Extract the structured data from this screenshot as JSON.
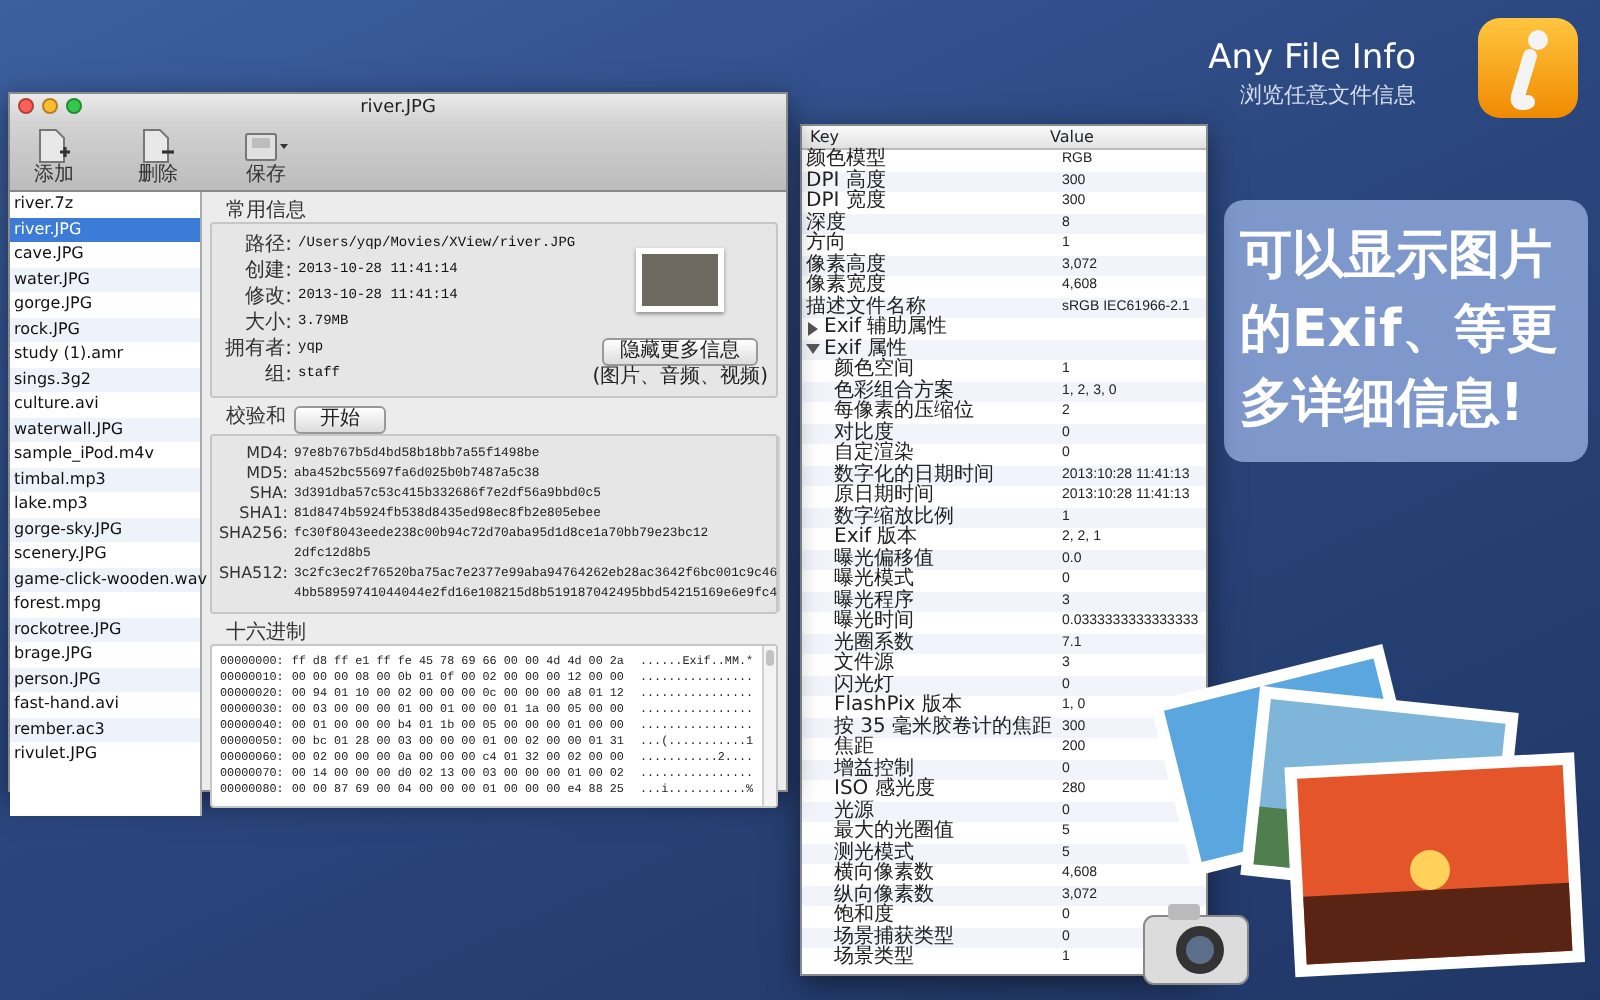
{
  "app": {
    "name": "Any File Info",
    "tagline": "浏览任意文件信息"
  },
  "callout": {
    "lines": [
      "可以显示图片",
      "的**Exif**、等更",
      "多详细信息!"
    ]
  },
  "main_window": {
    "title": "river.JPG",
    "toolbar": [
      {
        "kind": "add",
        "label": "添加"
      },
      {
        "kind": "remove",
        "label": "删除"
      },
      {
        "kind": "save",
        "label": "保存"
      }
    ],
    "files": [
      {
        "name": "river.7z",
        "selected": false
      },
      {
        "name": "river.JPG",
        "selected": true
      },
      {
        "name": "cave.JPG",
        "selected": false
      },
      {
        "name": "water.JPG",
        "selected": false
      },
      {
        "name": "gorge.JPG",
        "selected": false
      },
      {
        "name": "rock.JPG",
        "selected": false
      },
      {
        "name": "study (1).amr",
        "selected": false
      },
      {
        "name": "sings.3g2",
        "selected": false
      },
      {
        "name": "culture.avi",
        "selected": false
      },
      {
        "name": "waterwall.JPG",
        "selected": false
      },
      {
        "name": "sample_iPod.m4v",
        "selected": false
      },
      {
        "name": "timbal.mp3",
        "selected": false
      },
      {
        "name": "lake.mp3",
        "selected": false
      },
      {
        "name": "gorge-sky.JPG",
        "selected": false
      },
      {
        "name": "scenery.JPG",
        "selected": false
      },
      {
        "name": "game-click-wooden.wav",
        "selected": false
      },
      {
        "name": "forest.mpg",
        "selected": false
      },
      {
        "name": "rockotree.JPG",
        "selected": false
      },
      {
        "name": "brage.JPG",
        "selected": false
      },
      {
        "name": "person.JPG",
        "selected": false
      },
      {
        "name": "fast-hand.avi",
        "selected": false
      },
      {
        "name": "rember.ac3",
        "selected": false
      },
      {
        "name": "rivulet.JPG",
        "selected": false
      }
    ],
    "general": {
      "title": "常用信息",
      "fields": [
        {
          "label": "路径:",
          "value": "/Users/yqp/Movies/XView/river.JPG"
        },
        {
          "label": "创建:",
          "value": "2013-10-28 11:41:14"
        },
        {
          "label": "修改:",
          "value": "2013-10-28 11:41:14"
        },
        {
          "label": "大小:",
          "value": "3.79MB"
        },
        {
          "label": "拥有者:",
          "value": "yqp"
        },
        {
          "label": "组:",
          "value": "staff"
        }
      ],
      "action_button": "隐藏更多信息",
      "action_note": "(图片、音频、视频)"
    },
    "checksum": {
      "title": "校验和",
      "start_button": "开始",
      "hashes": [
        {
          "label": "MD4:",
          "lines": [
            "97e8b767b5d4bd58b18bb7a55f1498be"
          ]
        },
        {
          "label": "MD5:",
          "lines": [
            "aba452bc55697fa6d025b0b7487a5c38"
          ]
        },
        {
          "label": "SHA:",
          "lines": [
            "3d391dba57c53c415b332686f7e2df56a9bbd0c5"
          ]
        },
        {
          "label": "SHA1:",
          "lines": [
            "81d8474b5924fb538d8435ed98ec8fb2e805ebee"
          ]
        },
        {
          "label": "SHA256:",
          "lines": [
            "fc30f8043eede238c00b94c72d70aba95d1d8ce1a70bb79e23bc12",
            "2dfc12d8b5"
          ]
        },
        {
          "label": "SHA512:",
          "lines": [
            "3c2fc3ec2f76520ba75ac7e2377e99aba94764262eb28ac3642f6bc001c9c46",
            "4bb58959741044044e2fd16e108215d8b519187042495bbd54215169e6e9fc4"
          ]
        }
      ]
    },
    "hex": {
      "title": "十六进制",
      "lines": [
        {
          "offset": "00000000:",
          "bytes": "ff d8 ff e1 ff fe 45 78 69 66 00 00 4d 4d 00 2a",
          "ascii": "......Exif..MM.*"
        },
        {
          "offset": "00000010:",
          "bytes": "00 00 00 08 00 0b 01 0f 00 02 00 00 00 12 00 00",
          "ascii": "................"
        },
        {
          "offset": "00000020:",
          "bytes": "00 94 01 10 00 02 00 00 00 0c 00 00 00 a8 01 12",
          "ascii": "................"
        },
        {
          "offset": "00000030:",
          "bytes": "00 03 00 00 00 01 00 01 00 00 01 1a 00 05 00 00",
          "ascii": "................"
        },
        {
          "offset": "00000040:",
          "bytes": "00 01 00 00 00 b4 01 1b 00 05 00 00 00 01 00 00",
          "ascii": "................"
        },
        {
          "offset": "00000050:",
          "bytes": "00 bc 01 28 00 03 00 00 00 01 00 02 00 00 01 31",
          "ascii": "...(...........1"
        },
        {
          "offset": "00000060:",
          "bytes": "00 02 00 00 00 0a 00 00 00 c4 01 32 00 02 00 00",
          "ascii": "...........2...."
        },
        {
          "offset": "00000070:",
          "bytes": "00 14 00 00 00 d0 02 13 00 03 00 00 00 01 00 02",
          "ascii": "................"
        },
        {
          "offset": "00000080:",
          "bytes": "00 00 87 69 00 04 00 00 00 01 00 00 00 e4 88 25",
          "ascii": "...i...........%"
        }
      ]
    }
  },
  "exif_window": {
    "columns": [
      "Key",
      "Value"
    ],
    "rows": [
      {
        "key": "颜色模型",
        "value": "RGB"
      },
      {
        "key": "DPI 高度",
        "value": "300"
      },
      {
        "key": "DPI 宽度",
        "value": "300"
      },
      {
        "key": "深度",
        "value": "8"
      },
      {
        "key": "方向",
        "value": "1"
      },
      {
        "key": "像素高度",
        "value": "3,072"
      },
      {
        "key": "像素宽度",
        "value": "4,608"
      },
      {
        "key": "描述文件名称",
        "value": "sRGB IEC61966-2.1"
      },
      {
        "key": "Exif 辅助属性",
        "expanded": false
      },
      {
        "key": "Exif 属性",
        "expanded": true,
        "children": [
          {
            "key": "颜色空间",
            "value": "1"
          },
          {
            "key": "色彩组合方案",
            "value": "1, 2, 3, 0"
          },
          {
            "key": "每像素的压缩位",
            "value": "2"
          },
          {
            "key": "对比度",
            "value": "0"
          },
          {
            "key": "自定渲染",
            "value": "0"
          },
          {
            "key": "数字化的日期时间",
            "value": "2013:10:28 11:41:13"
          },
          {
            "key": "原日期时间",
            "value": "2013:10:28 11:41:13"
          },
          {
            "key": "数字缩放比例",
            "value": "1"
          },
          {
            "key": "Exif 版本",
            "value": "2, 2, 1"
          },
          {
            "key": "曝光偏移值",
            "value": "0.0"
          },
          {
            "key": "曝光模式",
            "value": "0"
          },
          {
            "key": "曝光程序",
            "value": "3"
          },
          {
            "key": "曝光时间",
            "value": "0.0333333333333333"
          },
          {
            "key": "光圈系数",
            "value": "7.1"
          },
          {
            "key": "文件源",
            "value": "3"
          },
          {
            "key": "闪光灯",
            "value": "0"
          },
          {
            "key": "FlashPix 版本",
            "value": "1, 0"
          },
          {
            "key": "按 35 毫米胶卷计的焦距",
            "value": "300"
          },
          {
            "key": "焦距",
            "value": "200"
          },
          {
            "key": "增益控制",
            "value": "0"
          },
          {
            "key": "ISO 感光度",
            "value": "280"
          },
          {
            "key": "光源",
            "value": "0"
          },
          {
            "key": "最大的光圈值",
            "value": "5"
          },
          {
            "key": "测光模式",
            "value": "5"
          },
          {
            "key": "横向像素数",
            "value": "4,608"
          },
          {
            "key": "纵向像素数",
            "value": "3,072"
          },
          {
            "key": "饱和度",
            "value": "0"
          },
          {
            "key": "场景捕获类型",
            "value": "0"
          },
          {
            "key": "场景类型",
            "value": "1"
          }
        ]
      }
    ]
  }
}
